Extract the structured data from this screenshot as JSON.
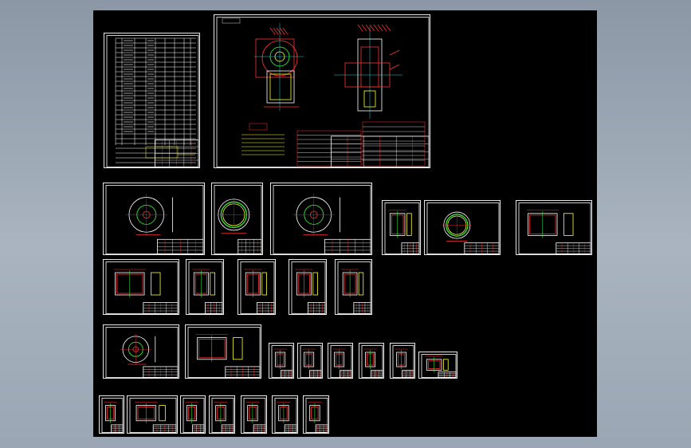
{
  "viewport": {
    "background": "#000000",
    "outer_background": "#9aa6b3"
  },
  "colors": {
    "frame": "#e8e8e8",
    "red": "#ff3030",
    "green": "#33ff33",
    "yellow": "#ffff33",
    "magenta": "#ff44ff",
    "cyan": "#33ffff"
  },
  "sheets": [
    {
      "id": "bom-list",
      "kind": "table"
    },
    {
      "id": "assembly-drawing",
      "kind": "assembly"
    },
    {
      "id": "housing-front",
      "kind": "circle-part"
    },
    {
      "id": "wheel-ring",
      "kind": "ring-part"
    },
    {
      "id": "volute-casing",
      "kind": "circle-part"
    },
    {
      "id": "flange-a",
      "kind": "small-part"
    },
    {
      "id": "impeller-side",
      "kind": "ring-part"
    },
    {
      "id": "frame-b",
      "kind": "small-part"
    },
    {
      "id": "hub-detail",
      "kind": "small-part"
    },
    {
      "id": "bar-a",
      "kind": "small-part"
    },
    {
      "id": "rod-b",
      "kind": "small-part"
    },
    {
      "id": "plate-c",
      "kind": "small-part"
    },
    {
      "id": "plate-d",
      "kind": "small-part"
    },
    {
      "id": "disk-a",
      "kind": "circle-part"
    },
    {
      "id": "inlet-frame",
      "kind": "small-part"
    },
    {
      "id": "part-row3-1",
      "kind": "small-part"
    },
    {
      "id": "part-row3-2",
      "kind": "small-part"
    },
    {
      "id": "part-row3-3",
      "kind": "small-part"
    },
    {
      "id": "part-row3-4",
      "kind": "small-part"
    },
    {
      "id": "part-row3-5",
      "kind": "small-part"
    },
    {
      "id": "part-row3-6",
      "kind": "small-part"
    },
    {
      "id": "part-row4-1",
      "kind": "small-part"
    },
    {
      "id": "part-row4-2",
      "kind": "small-part"
    },
    {
      "id": "part-row4-3",
      "kind": "small-part"
    },
    {
      "id": "part-row4-4",
      "kind": "small-part"
    },
    {
      "id": "part-row4-5",
      "kind": "small-part"
    },
    {
      "id": "part-row4-6",
      "kind": "small-part"
    },
    {
      "id": "part-row4-7",
      "kind": "small-part"
    }
  ]
}
